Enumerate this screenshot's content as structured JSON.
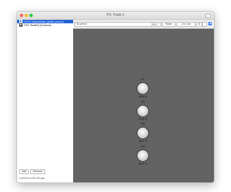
{
  "window": {
    "title": "FX: Track 1"
  },
  "plugins": [
    {
      "label": "VST3: BassWhale (jsfile) (mono)",
      "selected": true
    },
    {
      "label": "VST: ReaEQ (Cockos)",
      "selected": false
    }
  ],
  "left_buttons": {
    "add": "Add",
    "remove": "Remove"
  },
  "status": "0.0%/0.0% CPU 0/0 spls",
  "toolbar": {
    "preset_value": "No preset",
    "plus": "+",
    "param": "Param",
    "io": "1 in 1 out",
    "ui": "UI"
  },
  "knobs": [
    {
      "name": "F1",
      "value": "48.08 %"
    },
    {
      "name": "F2",
      "value": "50.00 %"
    },
    {
      "name": "F3",
      "value": "66.67 %"
    },
    {
      "name": "F4",
      "value": "66.22 %"
    }
  ],
  "colors": {
    "selection": "#1d60d8",
    "panel": "#636363"
  }
}
